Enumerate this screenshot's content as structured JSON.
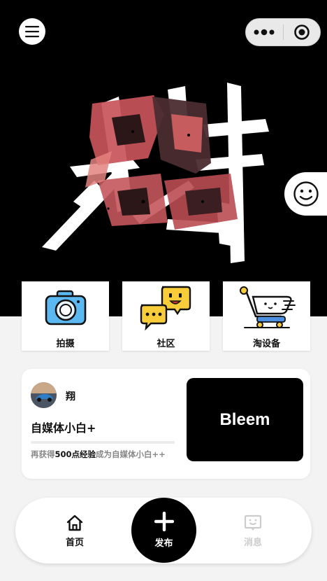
{
  "header": {
    "menu_icon": "menu-icon",
    "capsule": {
      "more_icon": "more-dots-icon",
      "close_icon": "target-circle-icon"
    }
  },
  "banner": {
    "art": "calligraphy-artwork",
    "side_icon": "smiley-face-icon"
  },
  "quick_actions": [
    {
      "label": "拍摄",
      "icon": "camera-icon"
    },
    {
      "label": "社区",
      "icon": "chat-bubbles-icon"
    },
    {
      "label": "淘设备",
      "icon": "shopping-cart-icon"
    }
  ],
  "user_card": {
    "name": "翔",
    "level_title": "自媒体小白+",
    "progress": 0,
    "hint_prefix": "再获得",
    "hint_points": "500点经验",
    "hint_suffix": "成为自媒体小白++",
    "promo_label": "Bleem"
  },
  "tabbar": {
    "home_label": "首页",
    "publish_label": "发布",
    "messages_label": "消息"
  },
  "colors": {
    "accent": "#000000",
    "inactive": "#cccccc",
    "background": "#f3f3f3"
  }
}
